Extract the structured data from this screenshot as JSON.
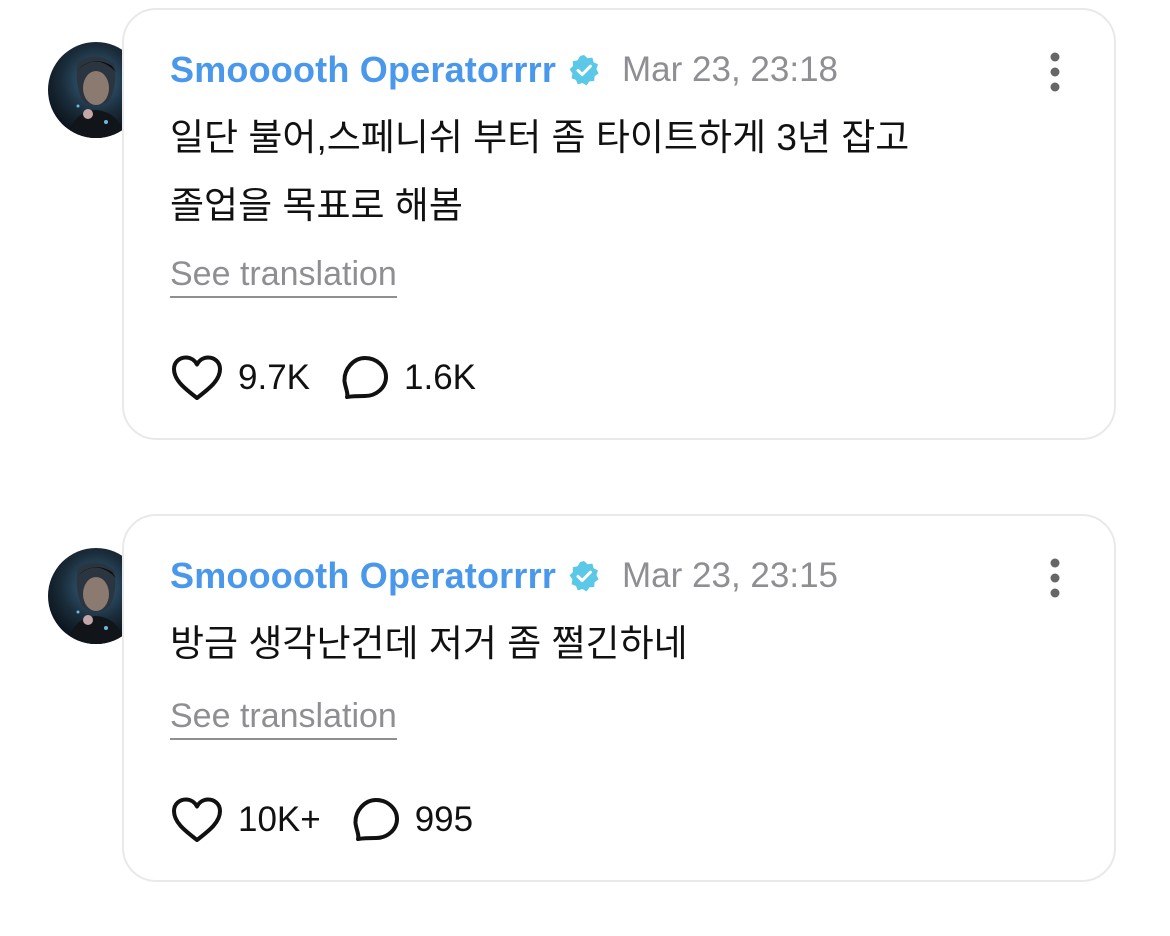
{
  "posts": [
    {
      "username": "Smooooth Operatorrrr",
      "timestamp": "Mar 23, 23:18",
      "lines": [
        "일단 불어,스페니쉬 부터 좀 타이트하게 3년 잡고",
        "졸업을 목표로 해봄"
      ],
      "translate_label": "See translation",
      "likes": "9.7K",
      "comments": "1.6K"
    },
    {
      "username": "Smooooth Operatorrrr",
      "timestamp": "Mar 23, 23:15",
      "lines": [
        "방금 생각난건데 저거 좀 쩔긴하네"
      ],
      "translate_label": "See translation",
      "likes": "10K+",
      "comments": "995"
    }
  ],
  "colors": {
    "username": "#4a98eb",
    "verified_badge": "#5ac8e6",
    "muted": "#8e8e93",
    "card_border": "#e9e9ea"
  },
  "icons": {
    "verified": "verified-badge-icon",
    "more": "more-vertical-icon",
    "like": "heart-icon",
    "comment": "comment-bubble-icon"
  }
}
